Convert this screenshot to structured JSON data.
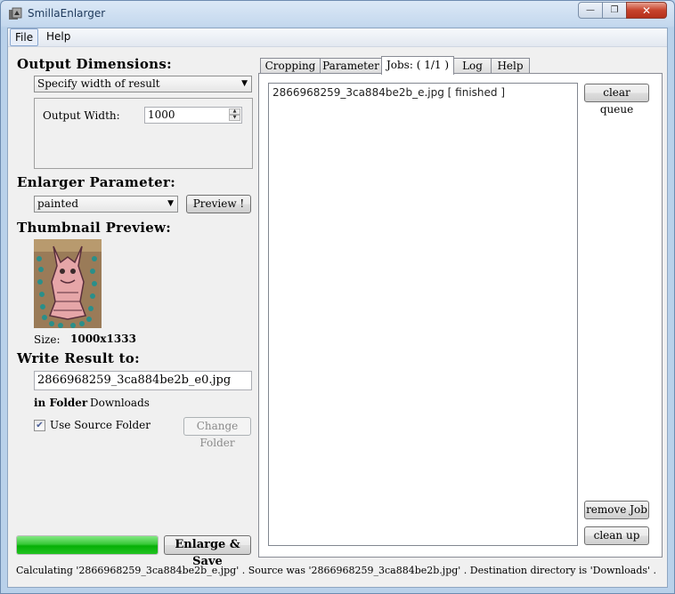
{
  "window": {
    "title": "SmillaEnlarger",
    "minimize": "—",
    "maximize": "❐",
    "close": "✕"
  },
  "menu": {
    "file": "File",
    "help": "Help"
  },
  "left": {
    "output_dimensions_label": "Output Dimensions:",
    "dimension_mode": "Specify width of result",
    "output_width_label": "Output Width:",
    "output_width_value": "1000",
    "enlarger_parameter_label": "Enlarger Parameter:",
    "preset": "painted",
    "preview_button": "Preview !",
    "thumbnail_label": "Thumbnail Preview:",
    "size_label": "Size:",
    "size_value": "1000x1333",
    "write_result_label": "Write Result to:",
    "output_filename": "2866968259_3ca884be2b_e0.jpg",
    "in_folder_label": "in Folder",
    "folder_name": "Downloads",
    "use_source_folder_label": "Use Source Folder",
    "use_source_folder_checked": true,
    "change_folder_button": "Change Folder",
    "progress": 1.0,
    "enlarge_save_button": "Enlarge & Save"
  },
  "tabs": [
    {
      "label": "Cropping",
      "active": false
    },
    {
      "label": "Parameter",
      "active": false
    },
    {
      "label": "Jobs: ( 1/1 )",
      "active": true
    },
    {
      "label": "Log",
      "active": false
    },
    {
      "label": "Help",
      "active": false
    }
  ],
  "jobs": {
    "items": [
      {
        "text": "2866968259_3ca884be2b_e.jpg [ finished ]"
      }
    ],
    "clear_queue_button": "clear queue",
    "remove_job_button": "remove Job",
    "clean_up_button": "clean up"
  },
  "status_text": "Calculating '2866968259_3ca884be2b_e.jpg' .  Source was '2866968259_3ca884be2b.jpg' .  Destination directory is 'Downloads' .",
  "colors": {
    "progress_green": "#1dbf1d",
    "title_text": "#1e395b"
  },
  "icons": {
    "app": "smilla-app-icon",
    "check": "check-icon",
    "dropdown": "chevron-down-icon"
  }
}
